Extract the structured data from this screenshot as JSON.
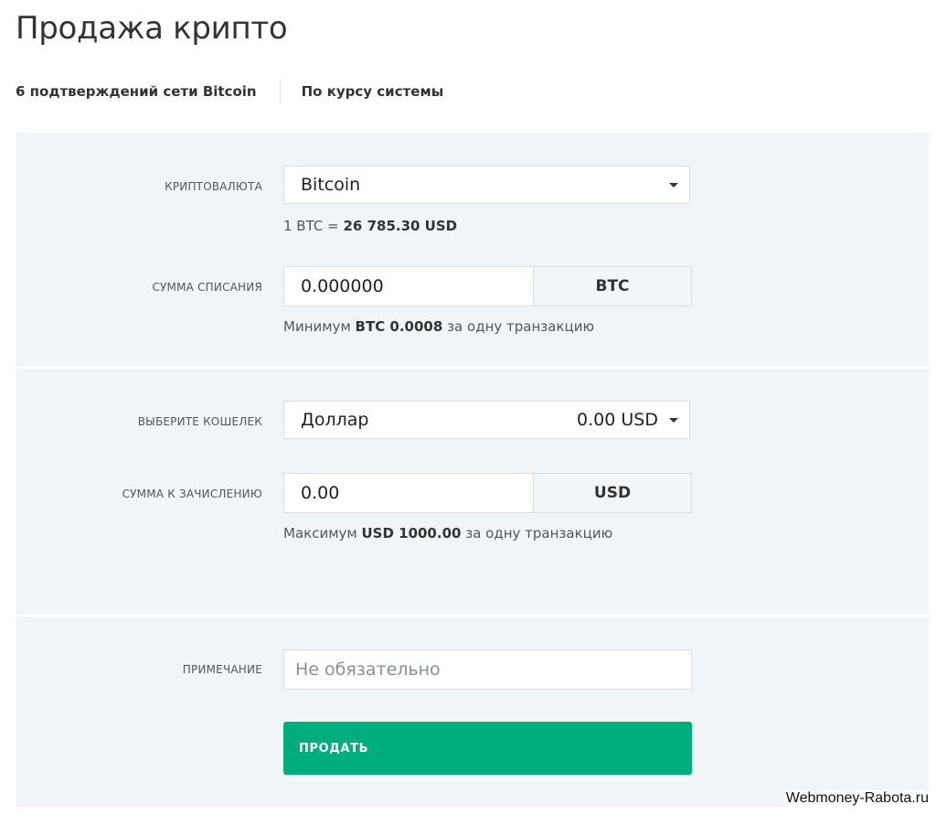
{
  "page": {
    "title": "Продажа крипто",
    "confirmations": "6 подтверждений сети Bitcoin",
    "rate_mode": "По курсу системы"
  },
  "crypto": {
    "label": "Криптовалюта",
    "selected": "Bitcoin",
    "rate_prefix": "1 BTC = ",
    "rate_value": "26 785.30 USD"
  },
  "debit": {
    "label": "Сумма списания",
    "value": "0.000000",
    "currency": "BTC",
    "hint_prefix": "Минимум ",
    "hint_value": "BTC 0.0008",
    "hint_suffix": " за одну транзакцию"
  },
  "wallet": {
    "label": "Выберите кошелек",
    "selected": "Доллар",
    "balance": "0.00 USD"
  },
  "credit": {
    "label": "Сумма к зачислению",
    "value": "0.00",
    "currency": "USD",
    "hint_prefix": "Максимум ",
    "hint_value": "USD 1000.00",
    "hint_suffix": " за одну транзакцию"
  },
  "note": {
    "label": "Примечание",
    "placeholder": "Не обязательно"
  },
  "actions": {
    "sell_label": "Продать"
  },
  "watermark": "Webmoney-Rabota.ru",
  "colors": {
    "accent": "#00ad7c",
    "panel_bg": "#f1f5f8"
  }
}
